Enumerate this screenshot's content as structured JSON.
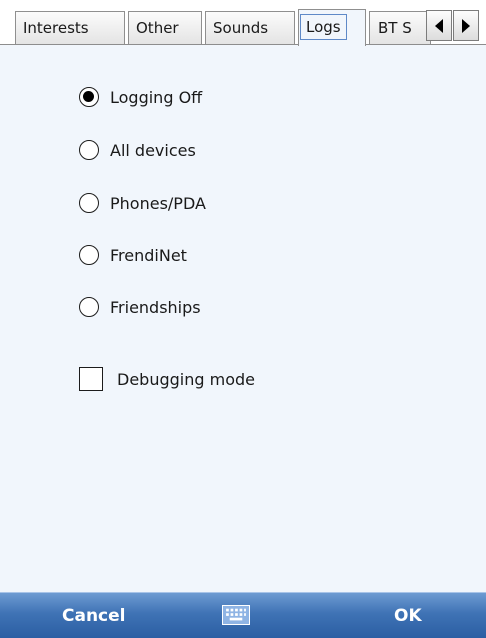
{
  "tabs": [
    {
      "label": "Interests",
      "active": false
    },
    {
      "label": "Other",
      "active": false
    },
    {
      "label": "Sounds",
      "active": false
    },
    {
      "label": "Logs",
      "active": true
    },
    {
      "label": "BT S",
      "active": false
    }
  ],
  "log_options": [
    {
      "label": "Logging Off",
      "selected": true
    },
    {
      "label": "All devices",
      "selected": false
    },
    {
      "label": "Phones/PDA",
      "selected": false
    },
    {
      "label": "FrendiNet",
      "selected": false
    },
    {
      "label": "Friendships",
      "selected": false
    }
  ],
  "debugging": {
    "label": "Debugging mode",
    "checked": false
  },
  "softkeys": {
    "left": "Cancel",
    "right": "OK"
  },
  "icons": {
    "tab_scroll_left": "arrow-left-icon",
    "tab_scroll_right": "arrow-right-icon",
    "input_panel": "keyboard-icon"
  },
  "colors": {
    "content_background": "#f1f6fc",
    "softkey_bar": "#3f73b5",
    "active_tab_focus": "#5e89c8"
  }
}
